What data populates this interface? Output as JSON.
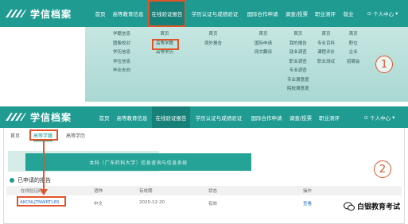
{
  "brand": {
    "logo_text": "学信档案",
    "accent": "#1f9b92",
    "highlight": "#e0552a"
  },
  "panel1": {
    "nav": [
      "首页",
      "高等教育信息",
      "在线验证报告",
      "学历认证与成绩验证",
      "国际合作申请",
      "调查/投票",
      "职业测评",
      "就业"
    ],
    "user_menu": "个人中心",
    "dropdown": {
      "col1": [
        "学籍信息",
        "图像校对",
        "学历信息",
        "学位信息",
        "毕业去向"
      ],
      "col2": [
        "首页",
        "高等学籍",
        "高等学历"
      ],
      "col3": [
        "首页",
        "境外报告"
      ],
      "col4": [
        "首页",
        "国际申请",
        "网文翻译"
      ],
      "col5": [
        "首页",
        "我的报告",
        "就业调查",
        "职业调查",
        "专业调查",
        "专业满意度",
        "院校满意度"
      ],
      "col6": [
        "首页",
        "专业百科",
        "课程评价",
        "职业测试"
      ],
      "col7": [
        "首页",
        "职位",
        "企业",
        "招聘会"
      ]
    },
    "badge": "1"
  },
  "panel2": {
    "nav": [
      "首页",
      "高等教育信息",
      "在线验证报告",
      "学历认证与成绩验证",
      "国际合作申请",
      "调查/投票",
      "职业测评"
    ],
    "user_menu": "个人中心",
    "breadcrumb": "首页",
    "subtabs": [
      "高等学籍",
      "高等学历"
    ],
    "banner_text": "本科（广东药科大学）信息查询与信息系统",
    "section_title": "已申请的报告",
    "table": {
      "headers": [
        "在线验证码",
        "语种",
        "有效期",
        "状态",
        "操作"
      ],
      "row": {
        "code": "AKCNLJTNWRTL8S",
        "language": "中文",
        "expiry": "2020-12-20",
        "status": "有效",
        "action": "查看"
      }
    },
    "badge": "2",
    "watermark": "白银教育考试"
  }
}
